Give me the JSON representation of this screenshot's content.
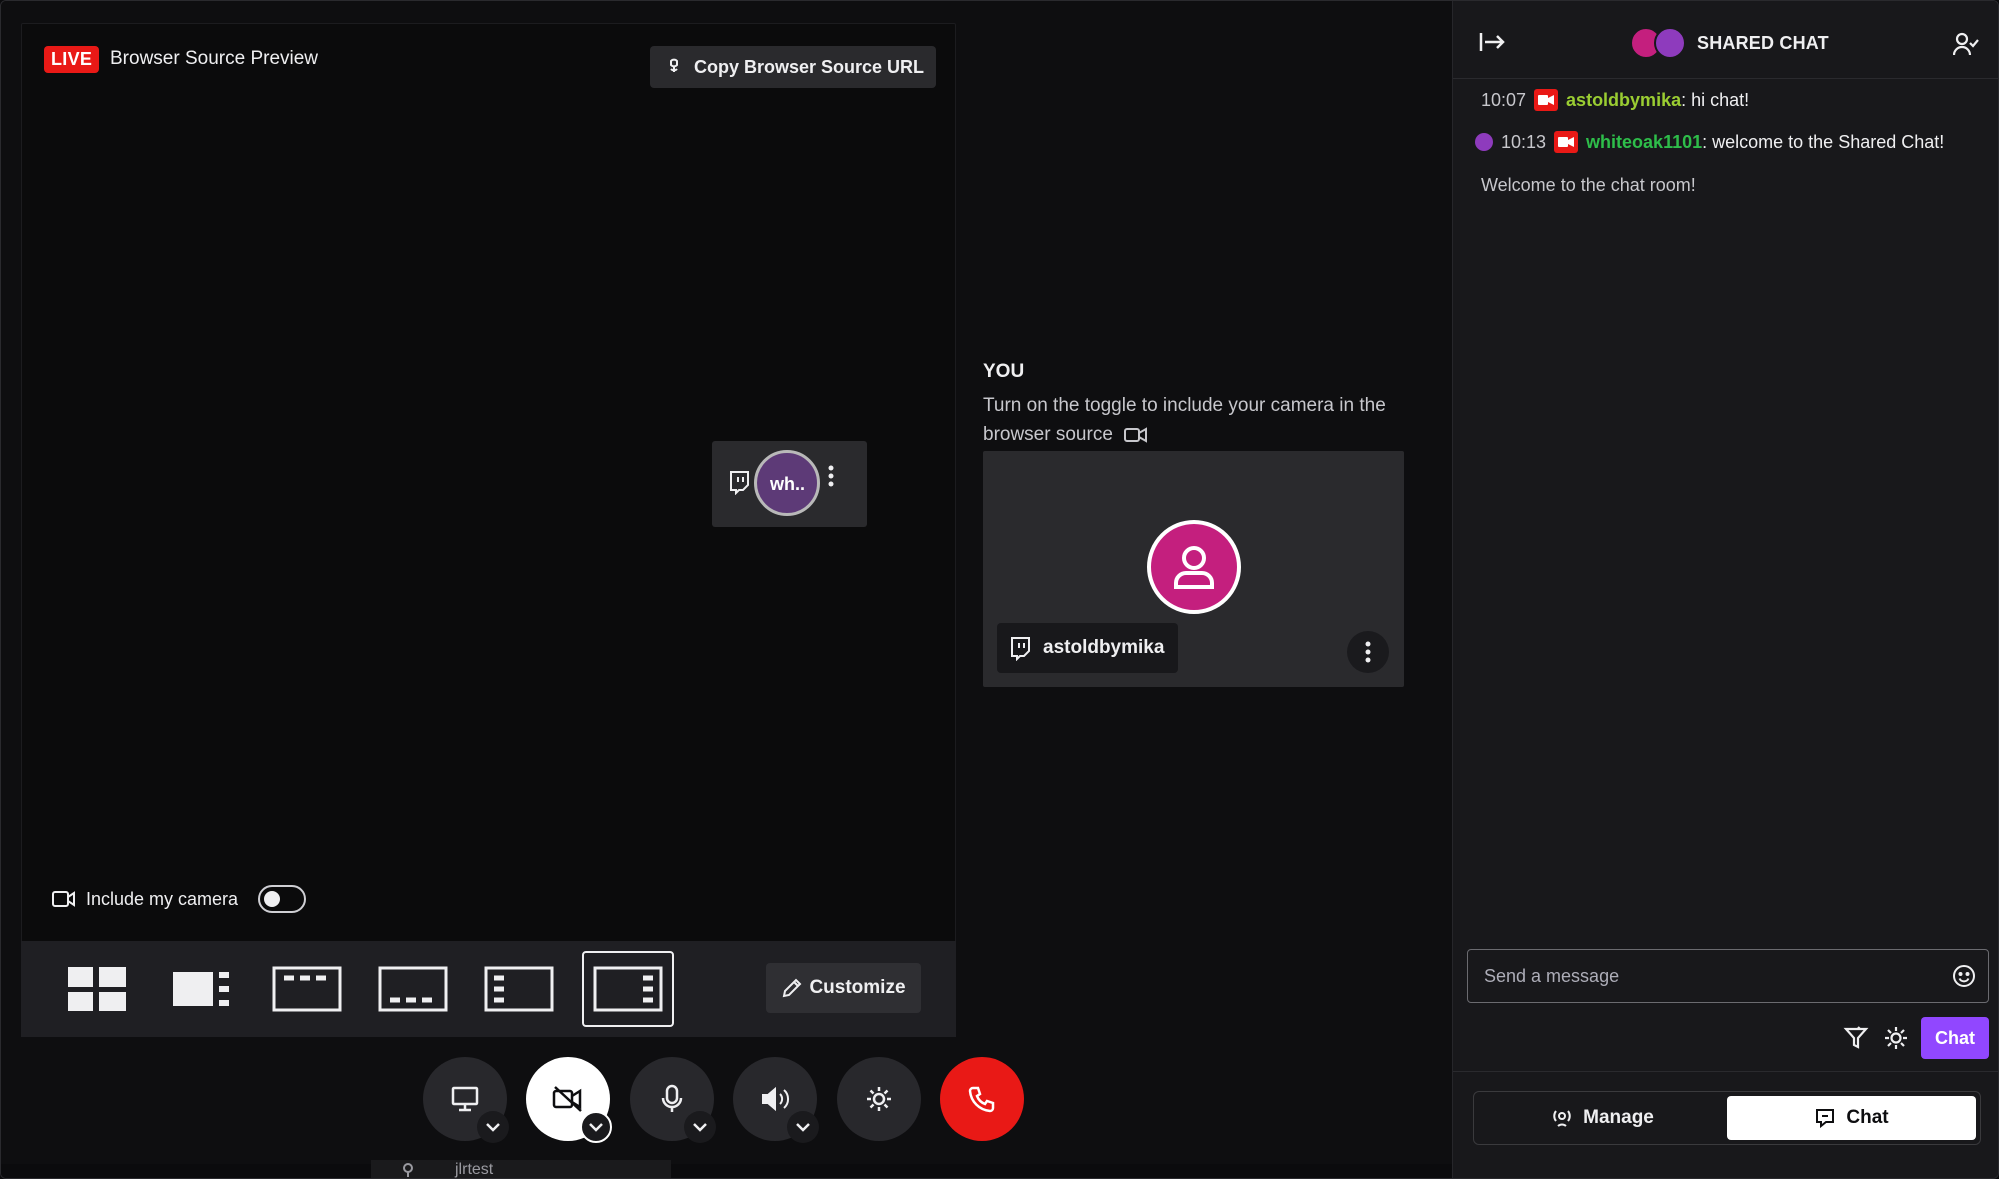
{
  "preview": {
    "live_badge": "LIVE",
    "title": "Browser Source Preview",
    "copy_button": "Copy Browser Source URL",
    "mini_tile_name": "wh..",
    "include_camera_label": "Include my camera",
    "include_camera_on": false,
    "customize_button": "Customize",
    "layouts": [
      "grid",
      "spotlight-side",
      "top-strip",
      "bottom-strip",
      "left-column",
      "right-column"
    ],
    "active_layout": "right-column"
  },
  "you": {
    "label": "YOU",
    "description": "Turn on the toggle to include your camera in the browser source",
    "username": "astoldbymika"
  },
  "controls": {
    "screen_share": "monitor-icon",
    "camera": "camera-off-icon",
    "mic": "mic-icon",
    "speaker": "speaker-icon",
    "settings": "gear-icon",
    "end_call": "phone-icon"
  },
  "bottom_strip": {
    "text": "jlrtest"
  },
  "chat": {
    "title": "SHARED CHAT",
    "messages": [
      {
        "time": "10:07",
        "user": "astoldbymika",
        "text": ": hi chat!"
      },
      {
        "time": "10:13",
        "user": "whiteoak1101",
        "text": ": welcome to the Shared Chat!"
      }
    ],
    "welcome": "Welcome to the chat room!",
    "input_placeholder": "Send a message",
    "send_button": "Chat",
    "tabs": [
      {
        "label": "Manage",
        "active": false
      },
      {
        "label": "Chat",
        "active": true
      }
    ]
  },
  "colors": {
    "live": "#e91916",
    "accent": "#9147ff",
    "avatar": "#c41f7e",
    "user1": "#9acd32",
    "user2": "#2ebd4a"
  }
}
